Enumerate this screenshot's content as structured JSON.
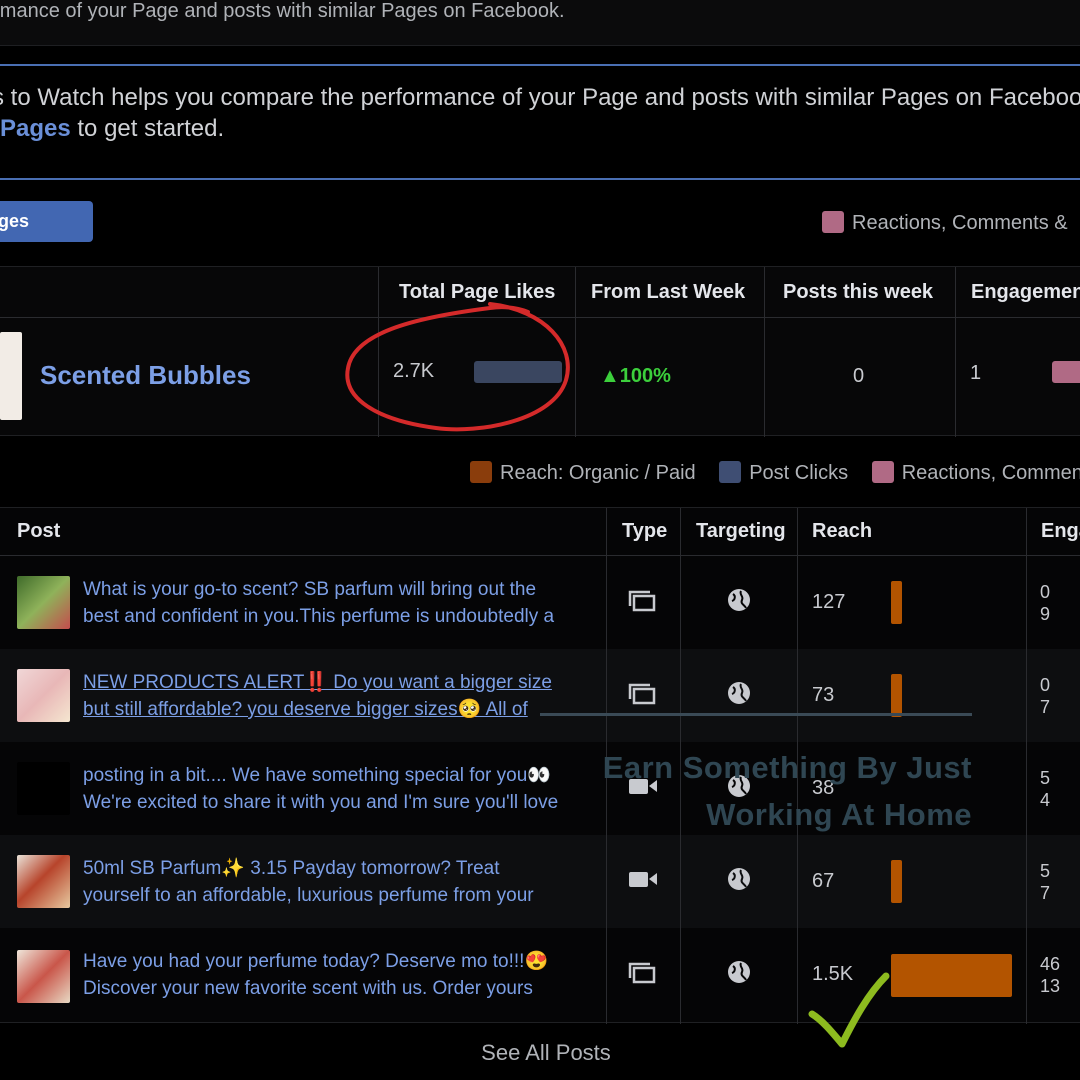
{
  "header": {
    "subtitle": "ormance of your Page and posts with similar Pages on Facebook.",
    "info_line1": "s to Watch helps you compare the performance of your Page and posts with similar Pages on Faceboo",
    "info_link": "Pages",
    "info_line2_rest": " to get started."
  },
  "toolbar": {
    "add_button_label": "ges",
    "legend_label": "Reactions, Comments &"
  },
  "compare_table": {
    "headers": [
      "Total Page Likes",
      "From Last Week",
      "Posts this week",
      "Engagemen"
    ],
    "page_name": "Scented Bubbles",
    "total_page_likes": "2.7K",
    "from_last_week": "▲100%",
    "posts_this_week": "0",
    "engagement": "1"
  },
  "legend": [
    {
      "label": "Reach: Organic / Paid",
      "color": "#8a3d0c"
    },
    {
      "label": "Post Clicks",
      "color": "#3f4e73"
    },
    {
      "label": "Reactions, Commen",
      "color": "#b06a85"
    }
  ],
  "posts_table": {
    "headers": [
      "Post",
      "Type",
      "Targeting",
      "Reach",
      "Enga"
    ],
    "rows": [
      {
        "line1": "What is your go-to scent? SB parfum will bring out the",
        "line2": "best and confident in you.This perfume is undoubtedly a",
        "type_icon": "album-icon",
        "reach": "127",
        "eng1": "0",
        "eng2": "9"
      },
      {
        "line1": "NEW PRODUCTS ALERT‼️ Do you want a bigger size",
        "line2": "but still affordable? you deserve bigger sizes🥺 All of",
        "type_icon": "album-icon",
        "reach": "73",
        "eng1": "0",
        "eng2": "7"
      },
      {
        "line1": "posting in a bit.... We have something special for you👀",
        "line2": "We're excited to share it with you and I'm sure you'll love",
        "type_icon": "video-icon",
        "reach": "38",
        "eng1": "5",
        "eng2": "4"
      },
      {
        "line1": "50ml SB Parfum✨ 3.15 Payday tomorrow? Treat",
        "line2": "yourself to an affordable, luxurious perfume from your",
        "type_icon": "video-icon",
        "reach": "67",
        "eng1": "5",
        "eng2": "7"
      },
      {
        "line1": "Have you had your perfume today? Deserve mo to!!!😍",
        "line2": "Discover your new favorite scent with us. Order yours",
        "type_icon": "album-icon",
        "reach": "1.5K",
        "eng1": "46",
        "eng2": "13"
      }
    ],
    "see_all": "See All Posts"
  },
  "overlay": {
    "line1": "Earn Something By Just",
    "line2": "Working At Home"
  },
  "colors": {
    "accent_blue": "#4267b2",
    "link_blue": "#7c9fe6",
    "reach_orange": "#b35400",
    "growth_green": "#3ccf3c",
    "annotation_red": "#d42a2a",
    "checkmark_green": "#8dbb1f"
  }
}
